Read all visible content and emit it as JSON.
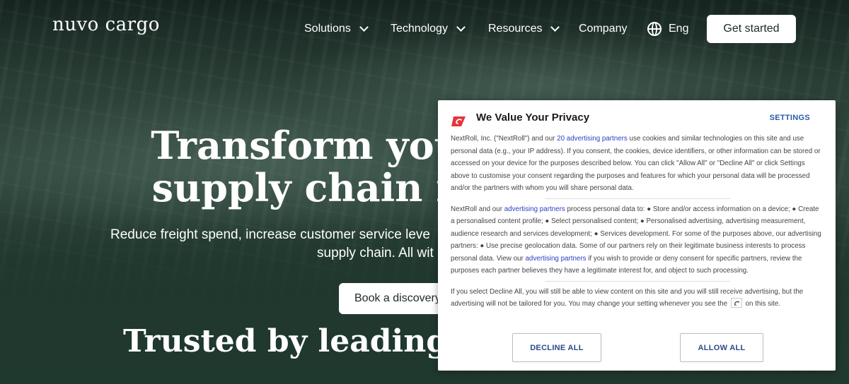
{
  "header": {
    "logo_text": "nuvo cargo",
    "nav": [
      {
        "label": "Solutions",
        "has_dropdown": true
      },
      {
        "label": "Technology",
        "has_dropdown": true
      },
      {
        "label": "Resources",
        "has_dropdown": true
      },
      {
        "label": "Company",
        "has_dropdown": false
      }
    ],
    "language": {
      "icon": "globe-icon",
      "label": "Eng"
    },
    "cta_label": "Get started"
  },
  "hero": {
    "title_line1": "Transform your l",
    "title_line2": "supply chain fo",
    "subtitle_line1": "Reduce freight spend, increase customer service leve",
    "subtitle_line2": "supply chain. All wit",
    "button_label": "Book a discovery",
    "trusted_heading": "Trusted by leading Nor"
  },
  "privacy_modal": {
    "logo_icon": "nextroll-logo-icon",
    "title": "We Value Your Privacy",
    "settings_label": "SETTINGS",
    "para1_prefix": "NextRoll, Inc. (\"NextRoll\") and our ",
    "para1_link": "20 advertising partners",
    "para1_suffix": " use cookies and similar technologies on this site and use personal data (e.g., your IP address). If you consent, the cookies, device identifiers, or other information can be stored or accessed on your device for the purposes described below. You can click \"Allow All\" or \"Decline All\" or click Settings above to customise your consent regarding the purposes and features for which your personal data will be processed and/or the partners with whom you will share personal data.",
    "para2_prefix": "NextRoll and our ",
    "para2_link": "advertising partners",
    "para2_middle": " process personal data to: ● Store and/or access information on a device; ● Create a personalised content profile; ● Select personalised content; ● Personalised advertising, advertising measurement, audience research and services development; ● Services development. For some of the purposes above, our advertising partners: ● Use precise geolocation data. Some of our partners rely on their legitimate business interests to process personal data. View our ",
    "para2_link2": "advertising partners",
    "para2_suffix": " if you wish to provide or deny consent for specific partners, review the purposes each partner believes they have a legitimate interest for, and object to such processing.",
    "para3_prefix": "If you select Decline All, you will still be able to view content on this site and you will still receive advertising, but the advertising will not be tailored for you. You may change your setting whenever you see the",
    "para3_suffix": "on this site.",
    "decline_label": "DECLINE ALL",
    "allow_label": "ALLOW ALL"
  },
  "colors": {
    "brand_dark_green": "#20392f",
    "link_blue": "#2b3fc2",
    "button_text_blue": "#2b4a8a",
    "nextroll_red": "#e8343b"
  }
}
